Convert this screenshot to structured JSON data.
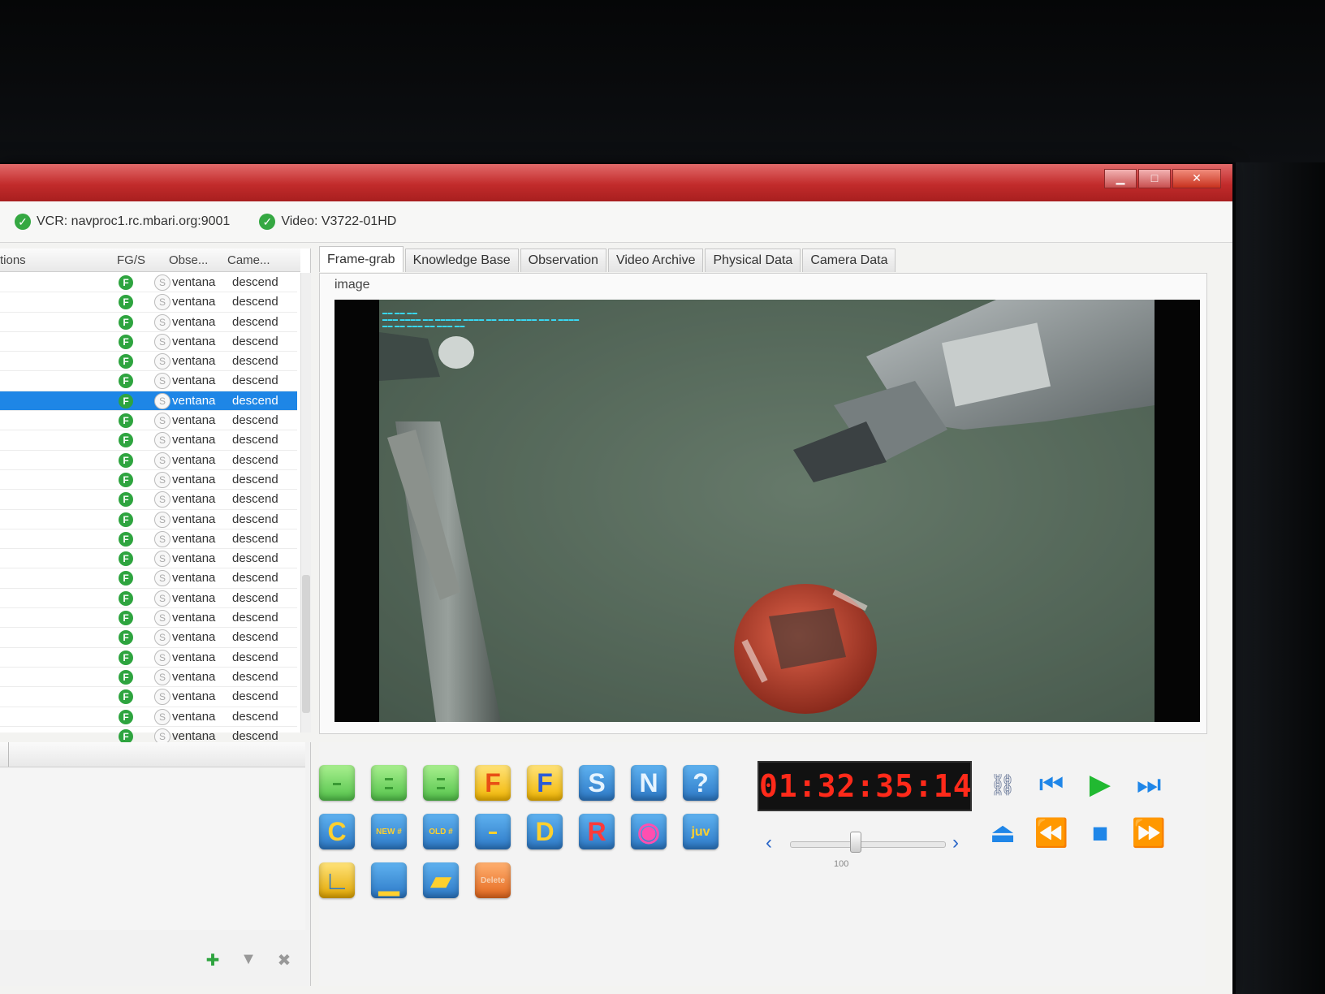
{
  "window": {
    "controls": [
      "▁",
      "□",
      "✕"
    ]
  },
  "status": {
    "vcr": "VCR: navproc1.rc.mbari.org:9001",
    "video": "Video: V3722-01HD"
  },
  "table": {
    "columns": [
      "tions",
      "FG/S",
      "Obse...",
      "Came..."
    ],
    "fg_icon": "F",
    "s_icon": "S",
    "rows": [
      {
        "observer": "ventana",
        "camera": "descend"
      },
      {
        "observer": "ventana",
        "camera": "descend"
      },
      {
        "observer": "ventana",
        "camera": "descend"
      },
      {
        "observer": "ventana",
        "camera": "descend"
      },
      {
        "observer": "ventana",
        "camera": "descend"
      },
      {
        "observer": "ventana",
        "camera": "descend"
      },
      {
        "observer": "ventana",
        "camera": "descend",
        "selected": true
      },
      {
        "observer": "ventana",
        "camera": "descend"
      },
      {
        "observer": "ventana",
        "camera": "descend"
      },
      {
        "observer": "ventana",
        "camera": "descend"
      },
      {
        "observer": "ventana",
        "camera": "descend"
      },
      {
        "observer": "ventana",
        "camera": "descend"
      },
      {
        "observer": "ventana",
        "camera": "descend"
      },
      {
        "observer": "ventana",
        "camera": "descend"
      },
      {
        "observer": "ventana",
        "camera": "descend"
      },
      {
        "observer": "ventana",
        "camera": "descend"
      },
      {
        "observer": "ventana",
        "camera": "descend"
      },
      {
        "observer": "ventana",
        "camera": "descend"
      },
      {
        "observer": "ventana",
        "camera": "descend"
      },
      {
        "observer": "ventana",
        "camera": "descend"
      },
      {
        "observer": "ventana",
        "camera": "descend"
      },
      {
        "observer": "ventana",
        "camera": "descend"
      },
      {
        "observer": "ventana",
        "camera": "descend"
      },
      {
        "observer": "ventana",
        "camera": "descend"
      }
    ]
  },
  "tabs": [
    "Frame-grab",
    "Knowledge Base",
    "Observation",
    "Video Archive",
    "Physical Data",
    "Camera Data"
  ],
  "image_panel": {
    "label": "image"
  },
  "buttons": {
    "row1": [
      "F",
      "F",
      "S",
      "N",
      "?"
    ],
    "row2": [
      "C",
      "NEW #",
      "OLD #",
      "D",
      "R",
      "juv"
    ],
    "delete_label": "Delete"
  },
  "timecode": "01:32:35:14",
  "speed": {
    "left_arrow": "‹",
    "right_arrow": "›",
    "value": "100"
  },
  "transport": {
    "rewind_step": "⏮",
    "play": "▶",
    "forward_step": "⏭",
    "eject": "⏏",
    "rewind": "⏪",
    "stop": "■",
    "fast_forward": "⏩"
  },
  "icons": {
    "status_ok": "check-circle-icon",
    "accent_selected": "#1e86e6",
    "timecode_color": "#ff2a1a"
  }
}
